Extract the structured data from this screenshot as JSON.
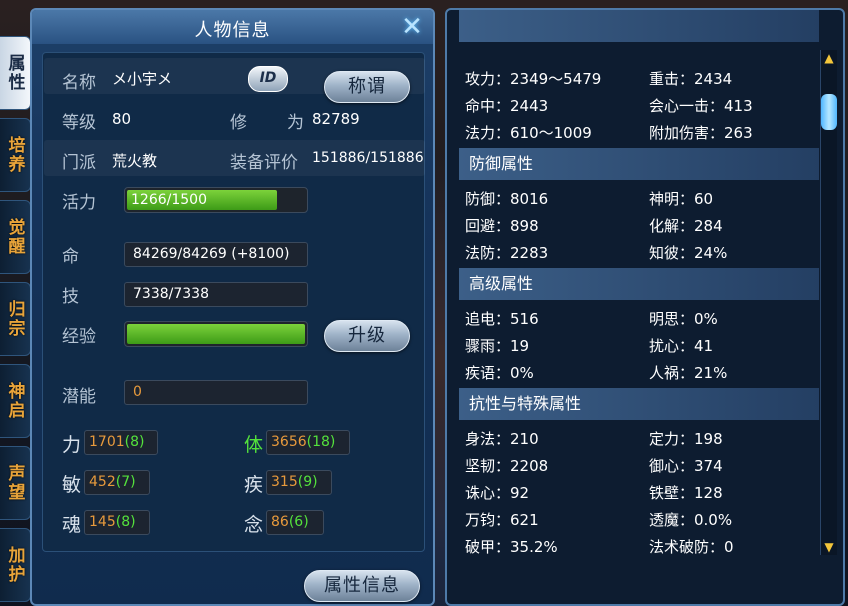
{
  "left_panel": {
    "title": "人物信息",
    "name_label": "名称",
    "name_value": "メ小宇メ",
    "id_badge": "ID",
    "title_button": "称谓",
    "level_label": "等级",
    "level_value": "80",
    "cultivation_label_a": "修",
    "cultivation_label_b": "为",
    "cultivation_value": "82789",
    "faction_label": "门派",
    "faction_value": "荒火教",
    "equip_label": "装备评价",
    "equip_value": "151886/151886",
    "vitality_label": "活力",
    "vitality_value": "1266/1500",
    "vitality_fill": 0.844,
    "life_label": "命",
    "life_value": "84269/84269 (+8100)",
    "skill_label": "技",
    "skill_value": "7338/7338",
    "exp_label": "经验",
    "exp_fill": 1.0,
    "upgrade_button": "升级",
    "potential_label": "潜能",
    "potential_value": "0",
    "stats": [
      {
        "label": "力",
        "base": "1701",
        "bonus": "(8)",
        "highlight": false
      },
      {
        "label": "体",
        "base": "3656",
        "bonus": "(18)",
        "highlight": true
      },
      {
        "label": "敏",
        "base": "452",
        "bonus": "(7)",
        "highlight": false
      },
      {
        "label": "疾",
        "base": "315",
        "bonus": "(9)",
        "highlight": false
      },
      {
        "label": "魂",
        "base": "145",
        "bonus": "(8)",
        "highlight": false
      },
      {
        "label": "念",
        "base": "86",
        "bonus": "(6)",
        "highlight": false
      }
    ],
    "attr_info_button": "属性信息"
  },
  "side_tabs": [
    "属性",
    "培养",
    "觉醒",
    "归宗",
    "神启",
    "声望",
    "加护"
  ],
  "right_panel": {
    "attack_rows": [
      [
        "攻力：2349～5479",
        "重击：2434"
      ],
      [
        "命中：2443",
        "会心一击：413"
      ],
      [
        "法力：610～1009",
        "附加伤害：263"
      ]
    ],
    "defense_title": "防御属性",
    "defense_rows": [
      [
        "防御：8016",
        "神明：60"
      ],
      [
        "回避：898",
        "化解：284"
      ],
      [
        "法防：2283",
        "知彼：24%"
      ]
    ],
    "advanced_title": "高级属性",
    "advanced_rows": [
      [
        "追电：516",
        "明思：0%"
      ],
      [
        "骤雨：19",
        "扰心：41"
      ],
      [
        "疾语：0%",
        "人祸：21%"
      ]
    ],
    "resist_title": "抗性与特殊属性",
    "resist_rows": [
      [
        "身法：210",
        "定力：198"
      ],
      [
        "坚韧：2208",
        "御心：374"
      ],
      [
        "诛心：92",
        "铁壁：128"
      ],
      [
        "万钧：621",
        "透魔：0.0%"
      ],
      [
        "破甲：35.2%",
        "法术破防：0"
      ]
    ],
    "scroll_up": "▲",
    "scroll_down": "▼"
  }
}
